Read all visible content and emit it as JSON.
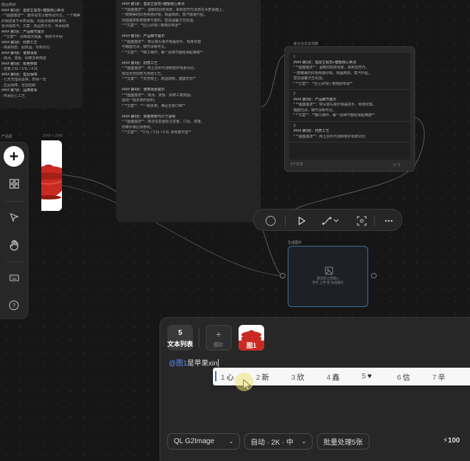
{
  "left_node": {
    "lines": [
      "度品类别:",
      "#### 第1张：首屏主视觉+模额核心卖点",
      "- **画面描述**：整体视觉以暖色调为主，一个精美",
      "砂锅放置于木质桌面，周围点缀新鲜食材，",
      "景点缀蒸汽。文案：高品质烹饪，传承经典",
      "#### 第2张：产品细节展示",
      "- **文案**：清晰展示锅盖、锅体与手柄",
      "#### 第3张：材质工艺",
      "- 陶瓷材质，耐高温，导热均匀",
      "#### 第4张：使用场景",
      "- 炖汤、煲饭、焖菜多种用途",
      "#### 第5张：规格参数",
      "- 容量 2.5L / 3.5L / 4.5L",
      "#### 第6张：售后保障",
      "- 七天无理由退换，质保一年",
      "- 正品保障，全国包邮",
      "#### 第7张：品牌故事",
      "- 传承匠心工艺"
    ]
  },
  "mid_node": {
    "lines": [
      "#### 第1张：首屏主视觉+模额核心卖点",
      "* **画面描述**：温暖的厨房场景，柔和自然光洒落在木质桌面上，",
      "一款精美的红色陶瓷砂锅，锅盖微启，蒸汽袅袅升起，",
      "周围摆放新鲜蔬菜与香料，营造温馨烹饪氛围。",
      "* **文案**：**匠心砂锅 | 慢炖好味道**",
      "",
      "#### 第2张：产品细节展示",
      "* **画面描述**：特写镜头展示锅盖把手、锅身纹理",
      "与釉面光泽，细节清晰可见。",
      "* **文案**：**精工细作，每一处细节都经得起推敲**",
      "",
      "#### 第3张：材质工艺",
      "* **画面描述**：陶土原料与烧制窑炉场景对比，",
      "突出天然材质与传统工艺。",
      "* **文案**：**天然陶土，高温烧制，健康无忧**",
      "",
      "#### 第4张：使用场景展示",
      "* **画面描述**：炖汤、煲饭、焖菜三格拼图，",
      "展现一锅多用的便利。",
      "* **文案**：**一锅多用，满足全家口味**",
      "",
      "#### 第5张：规格参数与尺寸说明",
      "* **画面描述**：简洁信息图标注容量、口径、高度，",
      "附带手掌比例参照。",
      "* **文案**：**2.5L / 3.5L / 4.5L 多规格可选**"
    ]
  },
  "image_node": {
    "label": "产品图",
    "size": "2048 × 2048"
  },
  "text_list_node": {
    "title": "拆分为文本列表",
    "blocks": [
      {
        "index": "1",
        "lines": [
          "#### 第1张：首屏主视觉+模额核心卖点",
          "* **画面描述**：温暖的厨房场景，柔和自然光，",
          "一款精美的红色陶瓷砂锅，锅盖微启，蒸汽升起，",
          "营造温馨烹饪氛围。",
          "* **文案**：**匠心砂锅 | 慢炖好味道**"
        ]
      },
      {
        "index": "2",
        "lines": [
          "#### 第2张：产品细节展示",
          "* **画面描述**：特写镜头展示锅盖把手、锅身纹理，",
          "釉面光泽，细节清晰可见。",
          "* **文案**：**精工细作，每一处细节都经得起推敲**"
        ]
      },
      {
        "index": "3",
        "lines": [
          "#### 第3张：材质工艺",
          "* **画面描述**：陶土原料与烧制窑炉场景对比"
        ]
      }
    ],
    "footer": "5个文本",
    "pager": "1 / 1"
  },
  "gen_node": {
    "title": "生成图片",
    "hint_line1": "请连接上游输入",
    "hint_line2": "参考 上传 或 生成图片"
  },
  "input_panel": {
    "chips": {
      "text_list_count": "5",
      "text_list_label": "文本列表",
      "add_image_label": "图片",
      "image_ref_label": "图1"
    },
    "prompt": {
      "ref": "@图1",
      "text": "是苹果xin"
    },
    "model_select": "QL G2Image",
    "size_select": "自动 · 2K · 中",
    "batch_button": "批量处理5张",
    "credit": "100"
  },
  "ime": {
    "candidates": [
      {
        "n": "1",
        "t": "心"
      },
      {
        "n": "2",
        "t": "新"
      },
      {
        "n": "3",
        "t": "欣"
      },
      {
        "n": "4",
        "t": "鑫"
      },
      {
        "n": "5",
        "t": "♥"
      },
      {
        "n": "6",
        "t": "信"
      },
      {
        "n": "7",
        "t": "辛"
      }
    ]
  },
  "colors": {
    "accent": "#5b8ff9",
    "selection_border": "#3c6fa0",
    "canvas": "#161616",
    "product_red": "#c92b22"
  }
}
